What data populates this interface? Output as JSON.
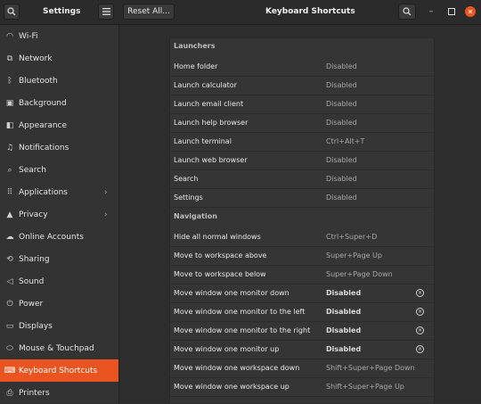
{
  "header": {
    "app_title": "Settings",
    "reset_label": "Reset All...",
    "page_title": "Keyboard Shortcuts"
  },
  "sidebar": {
    "items": [
      {
        "label": "Wi-Fi",
        "icon": "wifi-icon"
      },
      {
        "label": "Network",
        "icon": "network-icon"
      },
      {
        "label": "Bluetooth",
        "icon": "bluetooth-icon"
      },
      {
        "label": "Background",
        "icon": "background-icon"
      },
      {
        "label": "Appearance",
        "icon": "appearance-icon"
      },
      {
        "label": "Notifications",
        "icon": "bell-icon"
      },
      {
        "label": "Search",
        "icon": "search-icon"
      },
      {
        "label": "Applications",
        "icon": "applications-icon",
        "chevron": true
      },
      {
        "label": "Privacy",
        "icon": "privacy-icon",
        "chevron": true
      },
      {
        "label": "Online Accounts",
        "icon": "cloud-icon"
      },
      {
        "label": "Sharing",
        "icon": "sharing-icon"
      },
      {
        "label": "Sound",
        "icon": "speaker-icon"
      },
      {
        "label": "Power",
        "icon": "power-icon"
      },
      {
        "label": "Displays",
        "icon": "display-icon"
      },
      {
        "label": "Mouse & Touchpad",
        "icon": "mouse-icon"
      },
      {
        "label": "Keyboard Shortcuts",
        "icon": "keyboard-icon",
        "active": true
      },
      {
        "label": "Printers",
        "icon": "printer-icon"
      }
    ]
  },
  "sections": [
    {
      "title": "Launchers",
      "rows": [
        {
          "name": "Home folder",
          "accel": "Disabled"
        },
        {
          "name": "Launch calculator",
          "accel": "Disabled"
        },
        {
          "name": "Launch email client",
          "accel": "Disabled"
        },
        {
          "name": "Launch help browser",
          "accel": "Disabled"
        },
        {
          "name": "Launch terminal",
          "accel": "Ctrl+Alt+T"
        },
        {
          "name": "Launch web browser",
          "accel": "Disabled"
        },
        {
          "name": "Search",
          "accel": "Disabled"
        },
        {
          "name": "Settings",
          "accel": "Disabled"
        }
      ]
    },
    {
      "title": "Navigation",
      "rows": [
        {
          "name": "Hide all normal windows",
          "accel": "Ctrl+Super+D"
        },
        {
          "name": "Move to workspace above",
          "accel": "Super+Page Up"
        },
        {
          "name": "Move to workspace below",
          "accel": "Super+Page Down"
        },
        {
          "name": "Move window one monitor down",
          "accel": "Disabled",
          "modified": true
        },
        {
          "name": "Move window one monitor to the left",
          "accel": "Disabled",
          "modified": true
        },
        {
          "name": "Move window one monitor to the right",
          "accel": "Disabled",
          "modified": true
        },
        {
          "name": "Move window one monitor up",
          "accel": "Disabled",
          "modified": true
        },
        {
          "name": "Move window one workspace down",
          "accel": "Shift+Super+Page Down"
        },
        {
          "name": "Move window one workspace up",
          "accel": "Shift+Super+Page Up"
        }
      ]
    }
  ]
}
